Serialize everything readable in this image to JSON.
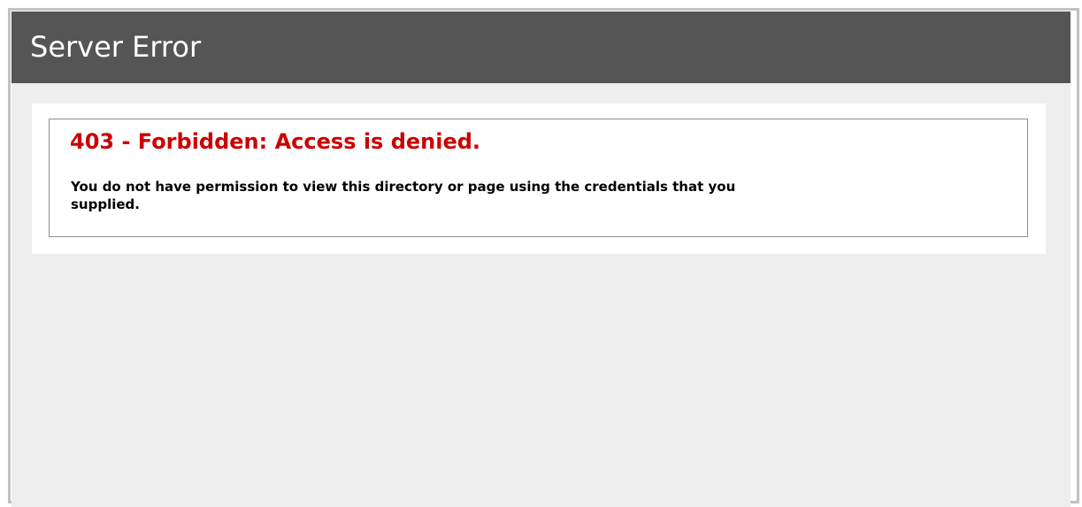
{
  "header": {
    "title": "Server Error"
  },
  "error": {
    "heading": "403 - Forbidden: Access is denied.",
    "message": "You do not have permission to view this directory or page using the credentials that you supplied."
  },
  "colors": {
    "header_background": "#555555",
    "page_background": "#eeeeee",
    "error_red": "#cc0000",
    "border_gray": "#c2c2c2"
  }
}
